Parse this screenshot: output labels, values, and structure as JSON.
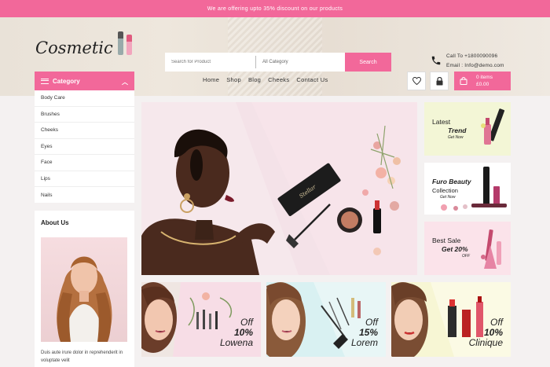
{
  "top_banner": "We are offering upto 35% discount on our products",
  "logo": "Cosmetic",
  "search": {
    "placeholder": "Search for Product",
    "category": "All Category",
    "button": "Search"
  },
  "contact": {
    "phone": "Call To +1800090096",
    "email": "Email : Info@demo.com"
  },
  "nav": [
    "Home",
    "Shop",
    "Blog",
    "Cheeks",
    "Contact Us"
  ],
  "cart": {
    "items": "0 items",
    "total": "£0.00"
  },
  "sidebar": {
    "category_title": "Category",
    "categories": [
      "Body Care",
      "Brushes",
      "Cheeks",
      "Eyes",
      "Face",
      "Lips",
      "Nails"
    ],
    "about_title": "About Us",
    "about_text": "Duis aute irure dolor in reprehenderit in voluptate velit"
  },
  "side_banners": [
    {
      "line1": "Latest",
      "line2": "Trend",
      "line3": "Get Now"
    },
    {
      "line1": "Furo Beauty",
      "line2": "Collection",
      "line3": "Get Now"
    },
    {
      "line1": "Best Sale",
      "line2": "Get 20%",
      "line3": "OFF"
    }
  ],
  "bottom_banners": [
    {
      "off": "Off",
      "percent": "10%",
      "brand": "Lowena"
    },
    {
      "off": "Off",
      "percent": "15%",
      "brand": "Lorem"
    },
    {
      "off": "Off",
      "percent": "10%",
      "brand": "Clinique"
    }
  ],
  "colors": {
    "accent": "#f2689a",
    "text": "#333333"
  }
}
